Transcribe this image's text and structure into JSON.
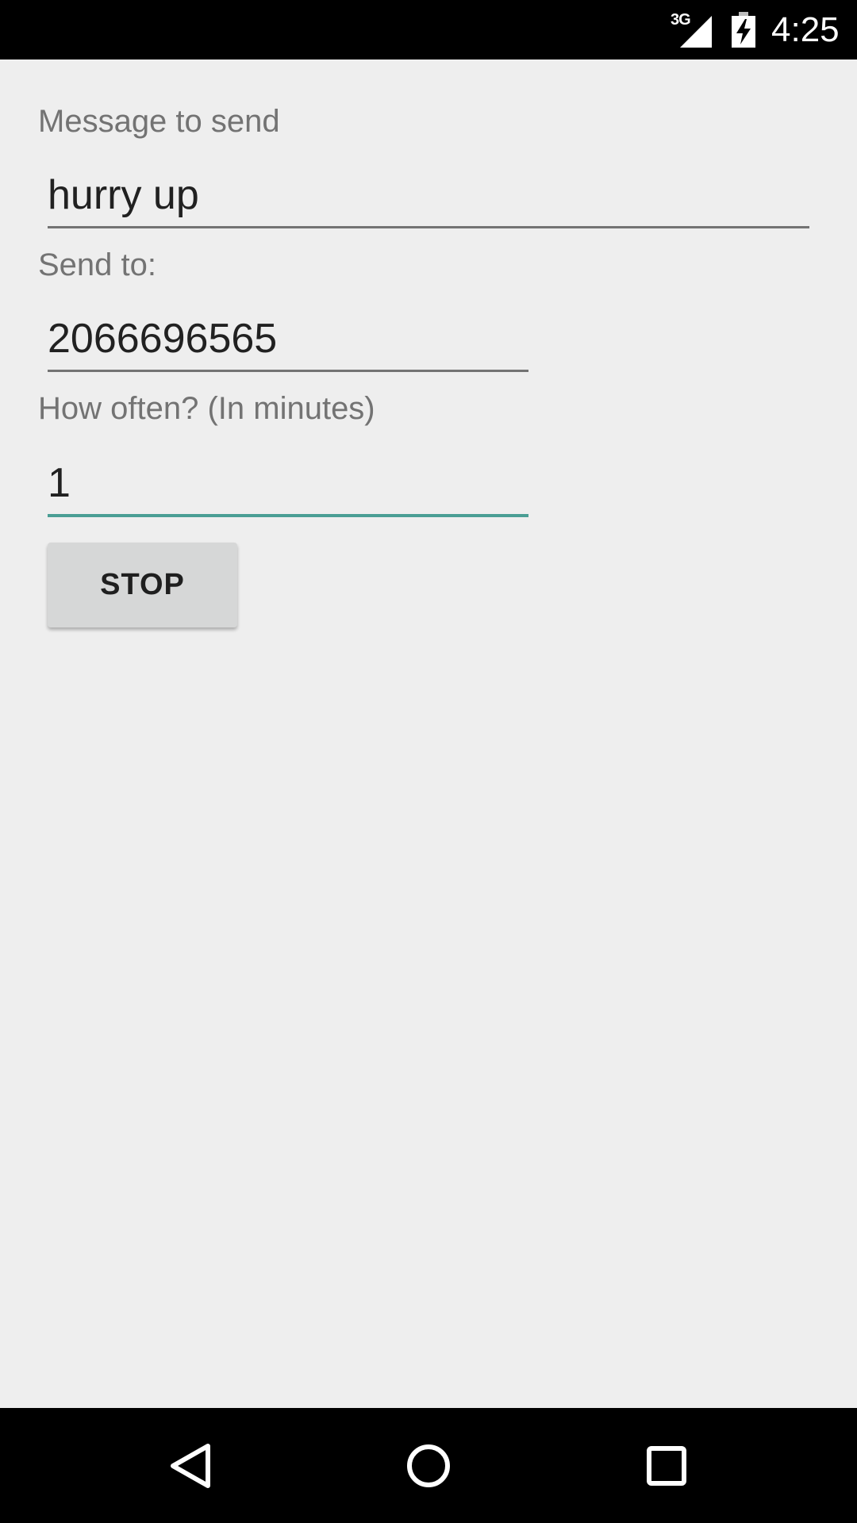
{
  "status_bar": {
    "network": "3G",
    "time": "4:25",
    "icons": [
      "signal-icon",
      "battery-charging-icon"
    ]
  },
  "form": {
    "message_label": "Message to send",
    "message_value": "hurry up",
    "sendto_label": "Send to:",
    "sendto_value": "2066696565",
    "often_label": "How often? (In minutes)",
    "often_value": "1",
    "stop_label": "STOP"
  },
  "nav_bar": {
    "icons": [
      "back-icon",
      "home-icon",
      "recents-icon"
    ]
  },
  "colors": {
    "background": "#eeeeee",
    "accent": "#4a9e94",
    "button": "#d6d7d7"
  }
}
